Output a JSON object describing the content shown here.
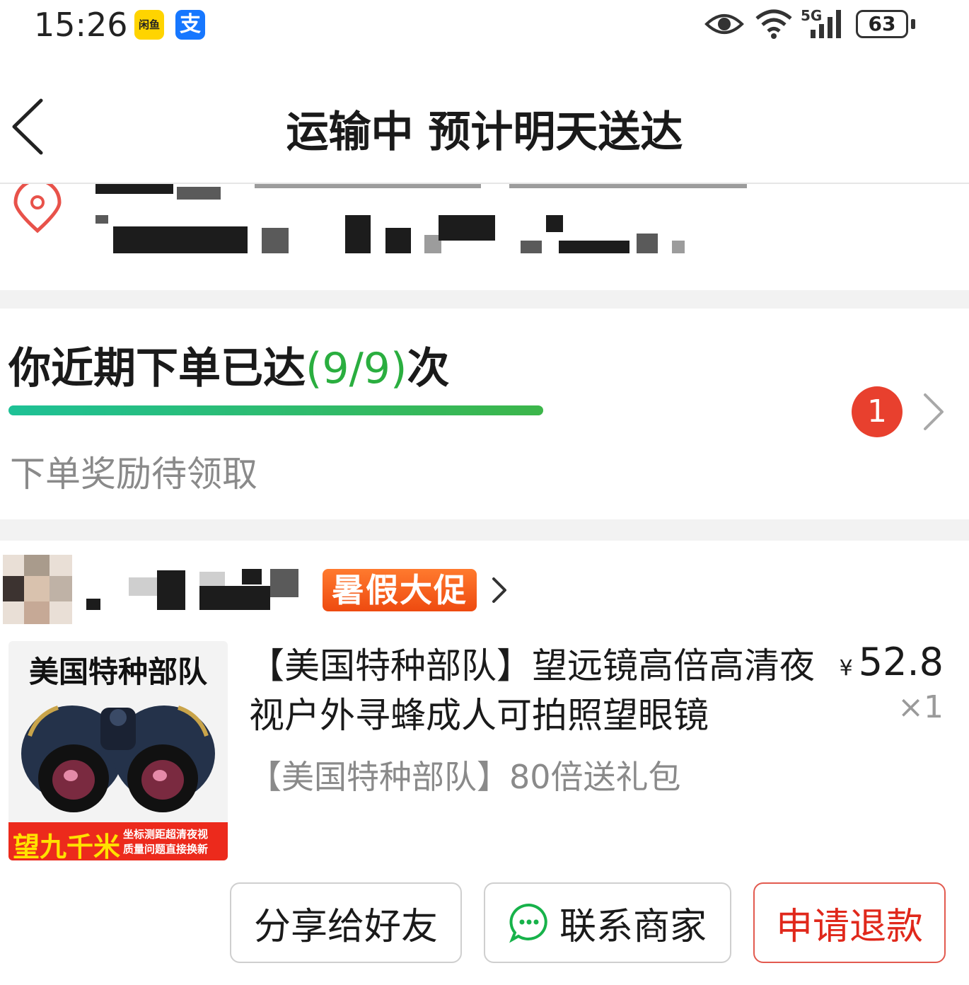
{
  "status_bar": {
    "time": "15:26",
    "apps": [
      "闲鱼",
      "支"
    ],
    "network_label": "5G",
    "battery": "63"
  },
  "nav": {
    "title": "运输中 预计明天送达"
  },
  "reward": {
    "prefix": "你近期下单已达",
    "count": "(9/9)",
    "suffix": "次",
    "progress": 1.0,
    "subtitle": "下单奖励待领取",
    "badge": "1"
  },
  "shop": {
    "promo_tag": "暑假大促"
  },
  "product": {
    "image_title": "美国特种部队",
    "image_banner": "望九千米",
    "image_banner_line1": "坐标测距超清夜视",
    "image_banner_line2": "质量问题直接换新",
    "name": "【美国特种部队】望远镜高倍高清夜视户外寻蜂成人可拍照望眼镜",
    "spec": "【美国特种部队】80倍送礼包",
    "currency": "¥",
    "price": "52.8",
    "quantity": "×1"
  },
  "actions": {
    "share": "分享给好友",
    "contact": "联系商家",
    "refund": "申请退款"
  },
  "colors": {
    "accent_green": "#2aae3f",
    "badge_red": "#e8402e",
    "promo_orange": "#ee4a10",
    "refund_red": "#e0281b"
  }
}
